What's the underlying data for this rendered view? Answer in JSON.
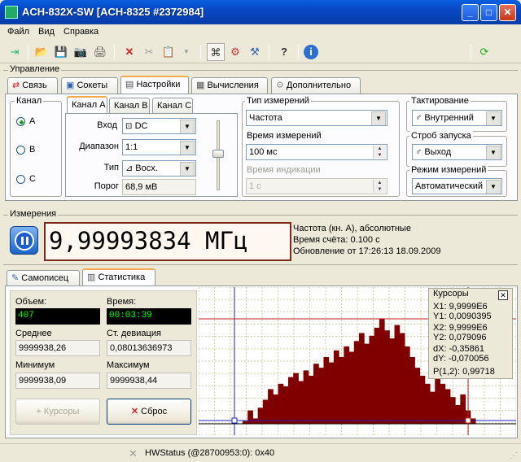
{
  "window": {
    "title": "ACH-832X-SW [ACH-8325 #2372984]"
  },
  "menu": [
    "Файл",
    "Вид",
    "Справка"
  ],
  "control_section": {
    "label": "Управление"
  },
  "main_tabs": [
    "Связь",
    "Сокеты",
    "Настройки",
    "Вычисления",
    "Дополнительно"
  ],
  "channel": {
    "label": "Канал",
    "options": [
      "A",
      "B",
      "C"
    ],
    "selected": "A"
  },
  "channel_tabs": [
    "Канал A",
    "Канал B",
    "Канал C"
  ],
  "input": {
    "vhod_label": "Вход",
    "vhod_value": "DC",
    "range_label": "Диапазон",
    "range_value": "1:1",
    "type_label": "Тип",
    "type_value": "Восх.",
    "threshold_label": "Порог",
    "threshold_value": "68,9 мВ"
  },
  "measure_type": {
    "label": "Тип измерений",
    "value": "Частота"
  },
  "measure_time": {
    "label": "Время измерений",
    "value": "100 мс"
  },
  "display_time": {
    "label": "Время индикации",
    "value": "1 с"
  },
  "clocking": {
    "label": "Тактирование",
    "value": "Внутренний"
  },
  "trigger": {
    "label": "Строб запуска",
    "value": "Выход"
  },
  "mode": {
    "label": "Режим измерений",
    "value": "Автоматический"
  },
  "measurement": {
    "section_label": "Измерения",
    "value": "9,99993834 МГц",
    "info1": "Частота (кн. A), абсолютные",
    "info2": "Время счёта: 0.100 с",
    "info3": "Обновление от 17:26:13 18.09.2009"
  },
  "bottom_tabs": [
    "Самописец",
    "Статистика"
  ],
  "stats": {
    "volume_label": "Объем:",
    "volume_value": "407",
    "time_label": "Время:",
    "time_value": "00:03:39",
    "mean_label": "Среднее",
    "mean_value": "9999938,26",
    "std_label": "Ст. девиация",
    "std_value": "0,08013636973",
    "min_label": "Минимум",
    "min_value": "9999938,09",
    "max_label": "Максимум",
    "max_value": "9999938,44",
    "cursors_button": "Курсоры",
    "reset_button": "Сброс"
  },
  "cursors": {
    "title": "Курсоры",
    "x1": "X1: 9,9999E6",
    "y1": "Y1: 0,0090395",
    "x2": "X2: 9,9999E6",
    "y2": "Y2: 0,079096",
    "dx": "dX: -0,35861",
    "dy": "dY: -0,070056",
    "p": "P(1,2): 0,99718"
  },
  "status": {
    "text": "HWStatus (@28700953:0): 0x40"
  },
  "chart_data": {
    "type": "bar",
    "values": [
      0.002,
      0.01,
      0.004,
      0.012,
      0.018,
      0.026,
      0.022,
      0.03,
      0.028,
      0.035,
      0.038,
      0.032,
      0.04,
      0.036,
      0.045,
      0.042,
      0.05,
      0.046,
      0.055,
      0.05,
      0.058,
      0.054,
      0.062,
      0.068,
      0.06,
      0.066,
      0.072,
      0.079,
      0.07,
      0.064,
      0.074,
      0.068,
      0.058,
      0.05,
      0.042,
      0.036,
      0.03,
      0.024,
      0.034,
      0.03,
      0.026,
      0.02,
      0.014,
      0.022,
      0.01,
      0.004
    ],
    "ylim": [
      0,
      0.1
    ],
    "grid": true,
    "bar_color": "#800000"
  }
}
